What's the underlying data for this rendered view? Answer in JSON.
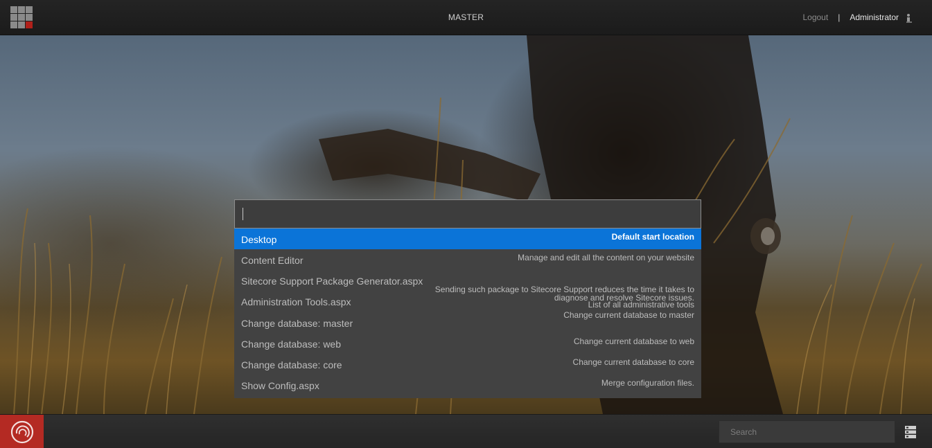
{
  "header": {
    "database": "MASTER",
    "logout_label": "Logout",
    "separator": "|",
    "username": "Administrator"
  },
  "search": {
    "value": "",
    "results": [
      {
        "name": "Desktop",
        "description": [
          "Default start location"
        ],
        "selected": true
      },
      {
        "name": "Content Editor",
        "description": [
          "Manage and edit all the content on your website"
        ]
      },
      {
        "name": "Sitecore Support Package Generator.aspx",
        "description": [
          "Sending such package to Sitecore Support reduces the time it takes to",
          "diagnose and resolve Sitecore issues."
        ]
      },
      {
        "name": "Administration Tools.aspx",
        "description": [
          "List of all administrative tools"
        ]
      },
      {
        "name": "Change database: master",
        "description": [
          "Change current database to master"
        ]
      },
      {
        "name": "Change database: web",
        "description": [
          "Change current database to web"
        ]
      },
      {
        "name": "Change database: core",
        "description": [
          "Change current database to core"
        ]
      },
      {
        "name": "Show Config.aspx",
        "description": [
          "Merge configuration files."
        ]
      }
    ]
  },
  "taskbar": {
    "search_placeholder": "Search"
  },
  "icons": {
    "app_grid": "app-grid-icon",
    "user": "user-icon",
    "start": "sitecore-logo-icon",
    "tray": "server-stack-icon"
  },
  "colors": {
    "selection": "#0b74d8",
    "start_button": "#b42a23"
  }
}
